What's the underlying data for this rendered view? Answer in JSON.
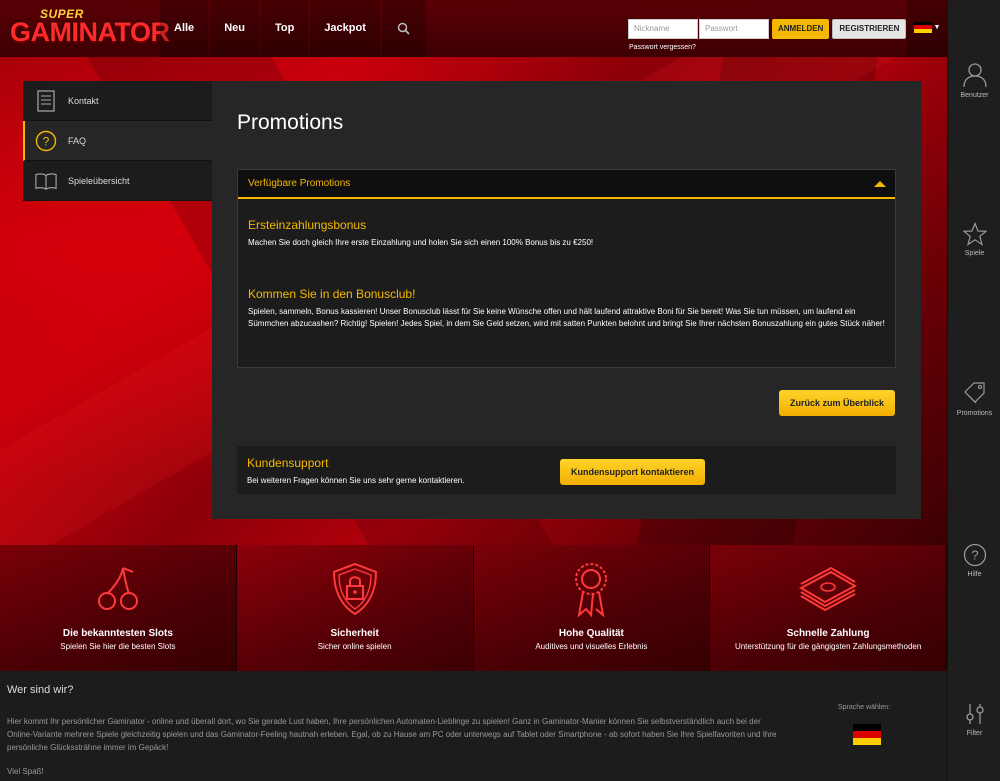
{
  "header": {
    "logo_super": "SUPER",
    "logo_main": "GAMINATOR",
    "nav": [
      "Alle",
      "Neu",
      "Top",
      "Jackpot"
    ],
    "nickname_placeholder": "Nickname",
    "password_placeholder": "Passwort",
    "login_label": "ANMELDEN",
    "register_label": "REGISTRIEREN",
    "forgot_label": "Passwort vergessen?"
  },
  "right_sidebar": {
    "user": "Benutzer",
    "games": "Spiele",
    "promotions": "Promotions",
    "help": "Hilfe",
    "filter": "Filter"
  },
  "left_menu": [
    "Kontakt",
    "FAQ",
    "Spieleübersicht"
  ],
  "main": {
    "title": "Promotions",
    "accordion_title": "Verfügbare Promotions",
    "promo1_title": "Ersteinzahlungsbonus",
    "promo1_text": "Machen Sie doch gleich Ihre erste Einzahlung und holen Sie sich einen 100% Bonus bis zu €250!",
    "promo2_title": "Kommen Sie in den Bonusclub!",
    "promo2_text": "Spielen, sammeln, Bonus kassieren! Unser Bonusclub lässt für Sie keine Wünsche offen und hält laufend attraktive Boni für Sie bereit! Was Sie tun müssen, um laufend ein Sümmchen abzucashen? Richtig! Spielen! Jedes Spiel, in dem Sie Geld setzen, wird mit satten Punkten belohnt und bringt Sie Ihrer nächsten Bonuszahlung ein gutes Stück näher!",
    "back_label": "Zurück zum Überblick",
    "support_title": "Kundensupport",
    "support_text": "Bei weiteren Fragen können Sie uns sehr gerne kontaktieren.",
    "support_button": "Kundensupport kontaktieren"
  },
  "features": [
    {
      "title": "Die bekanntesten Slots",
      "sub": "Spielen Sie hier die besten Slots",
      "icon": "cherries-icon"
    },
    {
      "title": "Sicherheit",
      "sub": "Sicher online spielen",
      "icon": "shield-lock-icon"
    },
    {
      "title": "Hohe Qualität",
      "sub": "Auditives und visuelles Erlebnis",
      "icon": "award-rosette-icon"
    },
    {
      "title": "Schnelle Zahlung",
      "sub": "Unterstützung für die gängigsten Zahlungsmethoden",
      "icon": "money-stack-icon"
    }
  ],
  "footer": {
    "title": "Wer sind wir?",
    "text": "Hier kommt Ihr persönlicher Gaminator - online und überall dort, wo Sie gerade Lust haben, Ihre persönlichen Automaten-Lieblinge zu spielen! Ganz in Gaminator-Manier können Sie selbstverständlich auch bei der Online-Variante mehrere Spiele gleichzeitig spielen und das Gaminator-Feeling hautnah erleben. Egal, ob zu Hause am PC oder unterwegs auf Tablet oder Smartphone - ab sofort haben Sie Ihre Spielfavoriten und Ihre persönliche Glückssträhne immer im Gepäck!",
    "closing": "Viel Spaß!",
    "language_label": "Sprache wählen:"
  },
  "colors": {
    "accent": "#f5b800",
    "flag_black": "#000000",
    "flag_red": "#dd0000",
    "flag_gold": "#ffce00"
  }
}
